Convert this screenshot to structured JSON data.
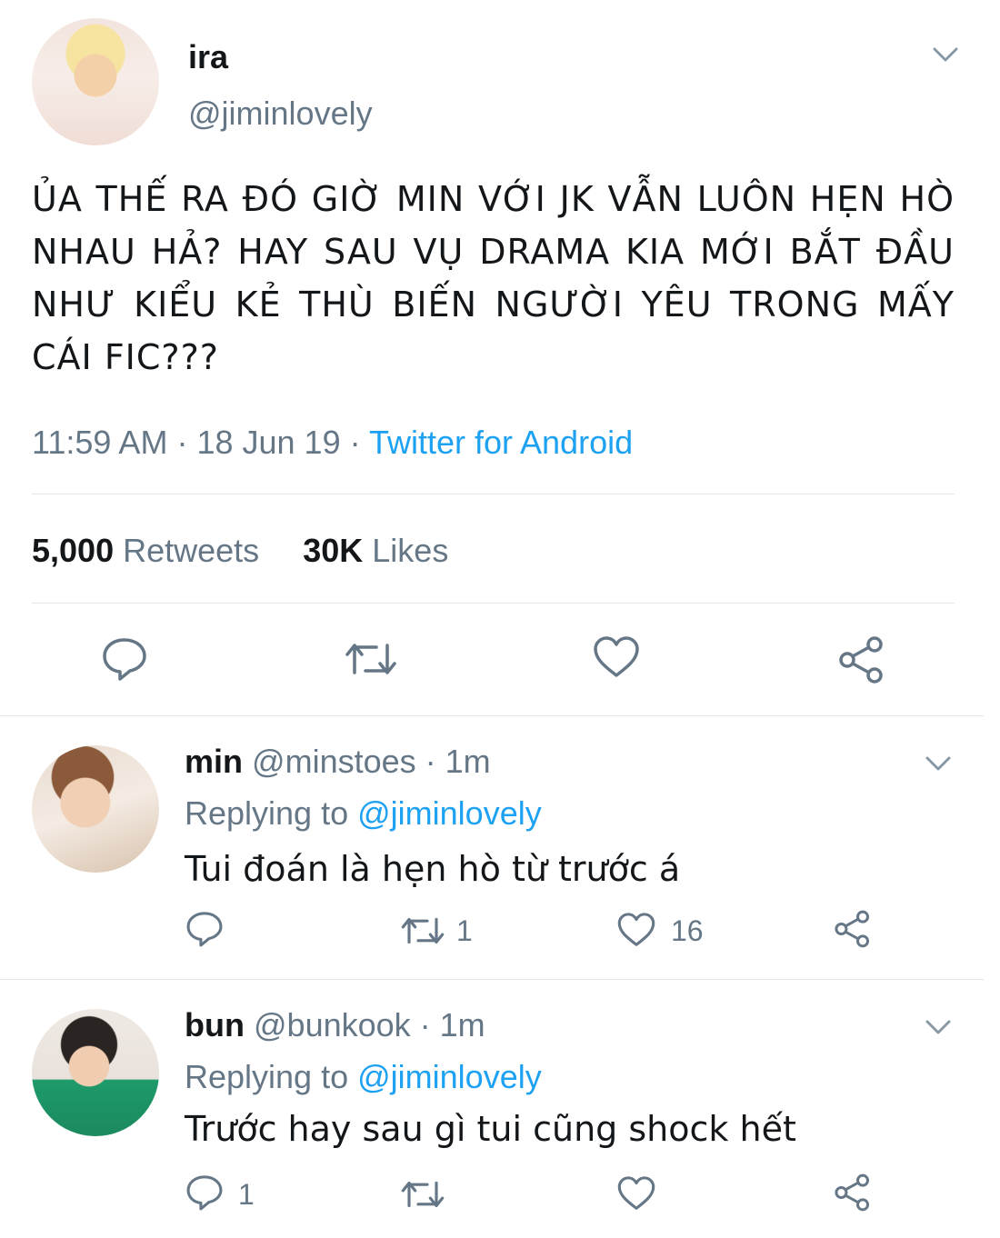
{
  "main_tweet": {
    "name": "ira",
    "handle": "@jiminlovely",
    "text": "ỦA THẾ RA ĐÓ GIỜ MIN VỚI JK VẪN LUÔN HẸN HÒ NHAU HẢ? HAY SAU VỤ DRAMA KIA MỚI BẮT ĐẦU NHƯ KIỂU KẺ THÙ BIẾN NGƯỜI YÊU TRONG MẤY CÁI FIC???",
    "time": "11:59 AM",
    "sep1": "·",
    "date": "18 Jun 19",
    "sep2": "·",
    "source": "Twitter for Android",
    "retweets_count": "5,000",
    "retweets_label": "Retweets",
    "likes_count": "30K",
    "likes_label": "Likes"
  },
  "replies": [
    {
      "name": "min",
      "handle": "@minstoes",
      "age": "· 1m",
      "replying_prefix": "Replying to",
      "replying_to": "@jiminlovely",
      "text": "Tui đoán là hẹn hò từ trước á",
      "reply_count": "",
      "retweet_count": "1",
      "like_count": "16"
    },
    {
      "name": "bun",
      "handle": "@bunkook",
      "age": "· 1m",
      "replying_prefix": "Replying to",
      "replying_to": "@jiminlovely",
      "text": "Trước hay sau gì tui cũng shock hết",
      "reply_count": "1",
      "retweet_count": "",
      "like_count": ""
    }
  ],
  "icons": {
    "reply": "reply-icon",
    "retweet": "retweet-icon",
    "like": "heart-icon",
    "share": "share-icon",
    "menu": "chevron-down-icon"
  },
  "colors": {
    "link_blue": "#1da1f2",
    "secondary_grey": "#657786",
    "divider": "#e1e8ed"
  }
}
